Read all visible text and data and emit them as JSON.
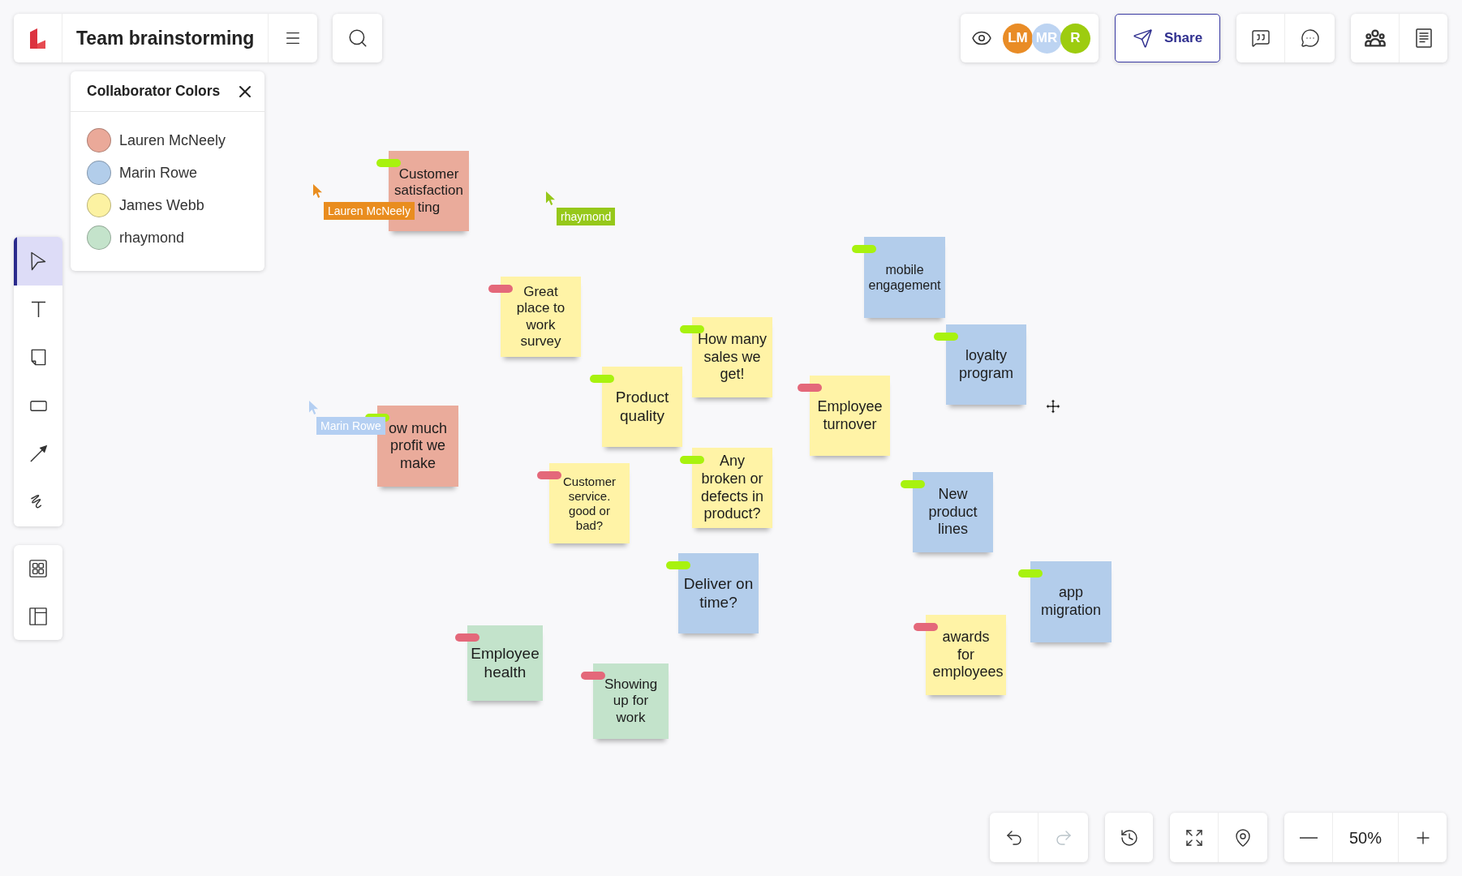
{
  "document": {
    "title": "Team brainstorming"
  },
  "presence": {
    "avatars": [
      {
        "initials": "LM",
        "color": "#e98c26"
      },
      {
        "initials": "MR",
        "color": "#bdd4f2"
      },
      {
        "initials": "R",
        "color": "#9dcc0f"
      }
    ]
  },
  "share_button": {
    "label": "Share"
  },
  "collaborator_panel": {
    "title": "Collaborator Colors",
    "collaborators": [
      {
        "name": "Lauren McNeely",
        "color": "#eaa999"
      },
      {
        "name": "Marin Rowe",
        "color": "#b2cdea"
      },
      {
        "name": "James Webb",
        "color": "#fcf2a2"
      },
      {
        "name": "rhaymond",
        "color": "#c4e3cb"
      }
    ]
  },
  "tools": [
    {
      "kind": "select",
      "selected": true
    },
    {
      "kind": "text",
      "selected": false
    },
    {
      "kind": "sticky",
      "selected": false
    },
    {
      "kind": "shape",
      "selected": false
    },
    {
      "kind": "line",
      "selected": false
    },
    {
      "kind": "draw",
      "selected": false
    }
  ],
  "notes": [
    {
      "text": "Customer satisfaction",
      "partial_text": "ting",
      "color": "#eaab9b",
      "tag": {
        "color": "#a8f20f"
      }
    },
    {
      "text": "mobile engagement",
      "color": "#b3cdeb",
      "tag": {
        "color": "#a8f20f"
      }
    },
    {
      "text": "Great place to work survey",
      "color": "#fff3a6",
      "tag": {
        "color": "#e4687a"
      }
    },
    {
      "text": "How many sales we get!",
      "color": "#fff3a6",
      "tag": {
        "color": "#a8f20f"
      }
    },
    {
      "text": "loyalty program",
      "color": "#b3cdeb",
      "tag": {
        "color": "#a8f20f"
      }
    },
    {
      "text": "Product quality",
      "color": "#fff3a6",
      "tag": {
        "color": "#a8f20f"
      }
    },
    {
      "text": "Employee turnover",
      "color": "#fff3a6",
      "tag": {
        "color": "#e4687a"
      }
    },
    {
      "text": "ow much profit we make",
      "color": "#eaab9b",
      "tag": {
        "color": "#a8f20f"
      }
    },
    {
      "text": "Customer service. good or bad?",
      "color": "#fff3a6",
      "tag": {
        "color": "#e4687a"
      }
    },
    {
      "text": "Any broken or defects in product?",
      "color": "#fff3a6",
      "tag": {
        "color": "#a8f20f"
      }
    },
    {
      "text": "New product lines",
      "color": "#b3cdeb",
      "tag": {
        "color": "#a8f20f"
      }
    },
    {
      "text": "Deliver on time?",
      "color": "#b3cdeb",
      "tag": {
        "color": "#a8f20f"
      }
    },
    {
      "text": "app migration",
      "color": "#b3cdeb",
      "tag": {
        "color": "#a8f20f"
      }
    },
    {
      "text": "Employee health",
      "color": "#c3e3cb",
      "tag": {
        "color": "#e4687a"
      }
    },
    {
      "text": "awards for employees",
      "color": "#fff3a6",
      "tag": {
        "color": "#e4687a"
      }
    },
    {
      "text": "Showing up for work",
      "color": "#c3e3cb",
      "tag": {
        "color": "#e4687a"
      }
    }
  ],
  "cursors": [
    {
      "name": "Lauren McNeely",
      "color": "#e98d1f"
    },
    {
      "name": "rhaymond",
      "color": "#96c81a"
    },
    {
      "name": "Marin Rowe",
      "color": "#b4cff2"
    }
  ],
  "history": {
    "undo": {
      "disabled": false
    },
    "redo": {
      "disabled": true
    }
  },
  "zoom": {
    "value": "50%"
  }
}
